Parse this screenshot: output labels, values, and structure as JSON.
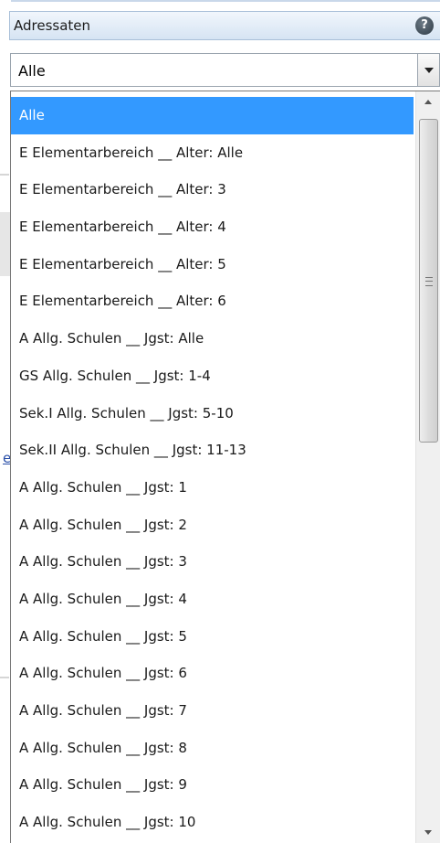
{
  "header": {
    "label": "Adressaten",
    "help_icon": "help-icon"
  },
  "select": {
    "value": "Alle",
    "arrow_icon": "chevron-down-icon"
  },
  "background": {
    "link_fragment": "e"
  },
  "dropdown": {
    "selected_index": 0,
    "options": [
      "Alle",
      "E Elementarbereich __ Alter: Alle",
      "E Elementarbereich __ Alter: 3",
      "E Elementarbereich __ Alter: 4",
      "E Elementarbereich __ Alter: 5",
      "E Elementarbereich __ Alter: 6",
      "A Allg. Schulen __ Jgst: Alle",
      "GS Allg. Schulen __ Jgst: 1-4",
      "Sek.I Allg. Schulen __ Jgst: 5-10",
      "Sek.II Allg. Schulen __ Jgst: 11-13",
      "A Allg. Schulen __ Jgst: 1",
      "A Allg. Schulen __ Jgst: 2",
      "A Allg. Schulen __ Jgst: 3",
      "A Allg. Schulen __ Jgst: 4",
      "A Allg. Schulen __ Jgst: 5",
      "A Allg. Schulen __ Jgst: 6",
      "A Allg. Schulen __ Jgst: 7",
      "A Allg. Schulen __ Jgst: 8",
      "A Allg. Schulen __ Jgst: 9",
      "A Allg. Schulen __ Jgst: 10"
    ]
  },
  "colors": {
    "selected_bg": "#3399ff",
    "selected_fg": "#ffffff",
    "header_border": "#a8bfd8"
  }
}
